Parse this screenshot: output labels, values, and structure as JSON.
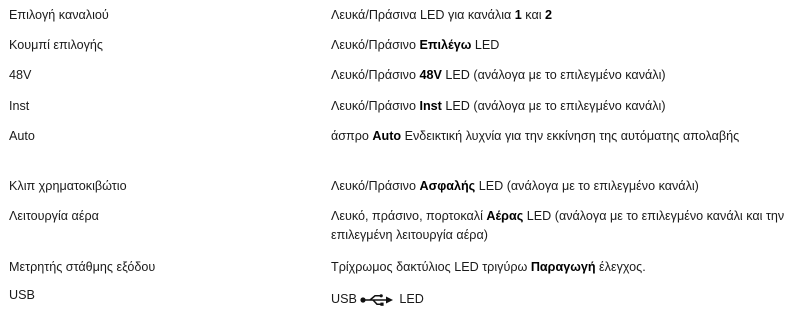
{
  "rows": [
    {
      "label": "Επιλογή καναλιού",
      "desc": [
        {
          "t": "Λευκά/Πράσινα LED για κανάλια "
        },
        {
          "t": "1",
          "b": true
        },
        {
          "t": " και "
        },
        {
          "t": "2",
          "b": true
        }
      ]
    },
    {
      "label": "Κουμπί επιλογής",
      "desc": [
        {
          "t": "Λευκό/Πράσινο "
        },
        {
          "t": "Επιλέγω",
          "b": true
        },
        {
          "t": " LED"
        }
      ]
    },
    {
      "label": "48V",
      "desc": [
        {
          "t": "Λευκό/Πράσινο "
        },
        {
          "t": "48V",
          "b": true
        },
        {
          "t": " LED (ανάλογα με το επιλεγμένο κανάλι)"
        }
      ]
    },
    {
      "label": "Inst",
      "desc": [
        {
          "t": "Λευκό/Πράσινο "
        },
        {
          "t": "Inst",
          "b": true
        },
        {
          "t": " LED (ανάλογα με το επιλεγμένο κανάλι)"
        }
      ]
    },
    {
      "label": "Auto",
      "desc": [
        {
          "t": "άσπρο "
        },
        {
          "t": "Auto",
          "b": true
        },
        {
          "t": " Ενδεικτική λυχνία για την εκκίνηση της αυτόματης απολαβής"
        }
      ]
    },
    {
      "label": "Κλιπ χρηματοκιβώτιο",
      "desc": [
        {
          "t": "Λευκό/Πράσινο "
        },
        {
          "t": "Ασφαλής",
          "b": true
        },
        {
          "t": " LED (ανάλογα με το επιλεγμένο κανάλι)"
        }
      ]
    },
    {
      "label": "Λειτουργία αέρα",
      "desc": [
        {
          "t": "Λευκό, πράσινο, πορτοκαλί "
        },
        {
          "t": "Αέρας",
          "b": true
        },
        {
          "t": " LED (ανάλογα με το επιλεγμένο κανάλι και την επιλεγμένη λειτουργία αέρα)"
        }
      ]
    },
    {
      "label": "Μετρητής στάθμης εξόδου",
      "desc": [
        {
          "t": "Τρίχρωμος δακτύλιος LED τριγύρω "
        },
        {
          "t": "Παραγωγή",
          "b": true
        },
        {
          "t": " έλεγχος."
        }
      ]
    },
    {
      "label": "USB",
      "desc": [
        {
          "t": "USB"
        },
        {
          "icon": "usb-icon"
        },
        {
          "t": " LED"
        }
      ]
    }
  ]
}
